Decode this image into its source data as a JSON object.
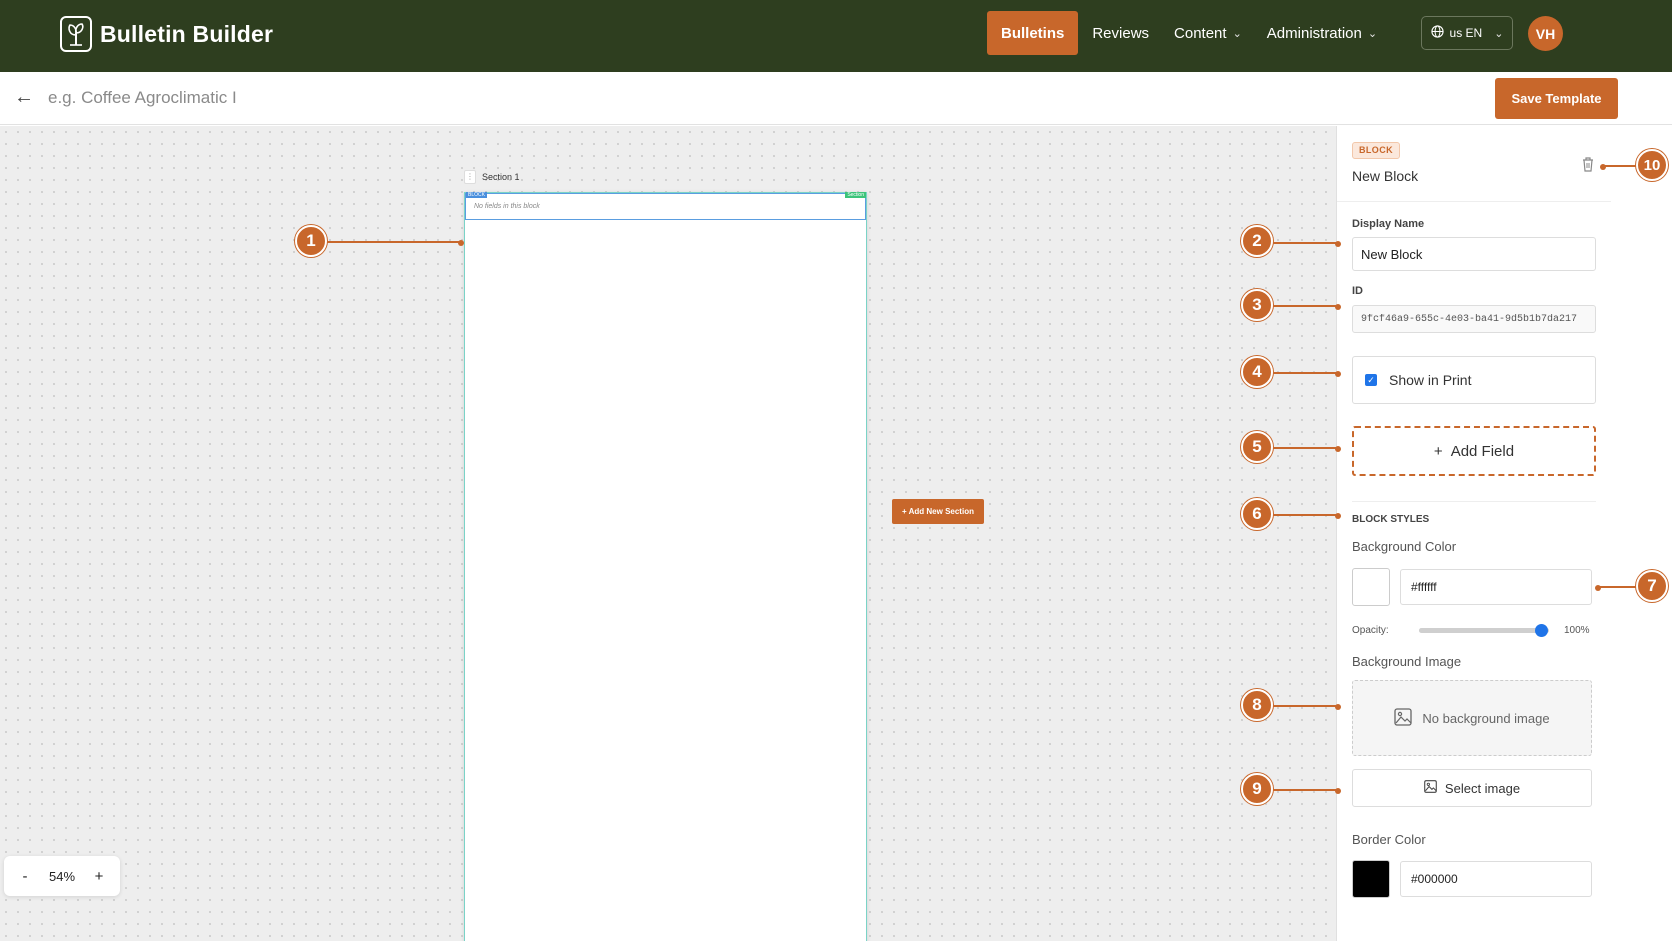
{
  "app": {
    "title": "Bulletin Builder",
    "logo_icon": "plant-leaf-icon"
  },
  "nav": {
    "items": [
      {
        "label": "Bulletins",
        "active": true
      },
      {
        "label": "Reviews"
      },
      {
        "label": "Content",
        "dropdown": true
      },
      {
        "label": "Administration",
        "dropdown": true
      }
    ],
    "language": "us EN",
    "avatar": "VH"
  },
  "subbar": {
    "title_placeholder": "e.g. Coffee Agroclimatic I",
    "save_label": "Save Template"
  },
  "canvas": {
    "section_label": "Section 1",
    "block_tag": "BLOCK",
    "section_tag": "Section",
    "empty_text": "No fields in this block",
    "add_section_label": "+ Add New Section",
    "zoom_level": "54%",
    "zoom_out": "-",
    "zoom_in": "+"
  },
  "panel": {
    "badge": "BLOCK",
    "header_name": "New Block",
    "display_name_label": "Display Name",
    "display_name_value": "New Block",
    "id_label": "ID",
    "id_value": "9fcf46a9-655c-4e03-ba41-9d5b1b7da217",
    "show_in_print_label": "Show in Print",
    "show_in_print_checked": true,
    "add_field_label": "Add Field",
    "block_styles_label": "BLOCK STYLES",
    "bg_color_label": "Background Color",
    "bg_color_value": "#ffffff",
    "opacity_label": "Opacity:",
    "opacity_value": "100%",
    "opacity_fraction": 1.0,
    "bg_image_label": "Background Image",
    "no_bg_image": "No background image",
    "select_image_label": "Select image",
    "border_color_label": "Border Color",
    "border_color_value": "#000000"
  },
  "annotations": [
    "1",
    "2",
    "3",
    "4",
    "5",
    "6",
    "7",
    "8",
    "9",
    "10"
  ],
  "colors": {
    "header_bg": "#2e3e1f",
    "accent": "#c8672b",
    "checkbox": "#1f74e8"
  }
}
